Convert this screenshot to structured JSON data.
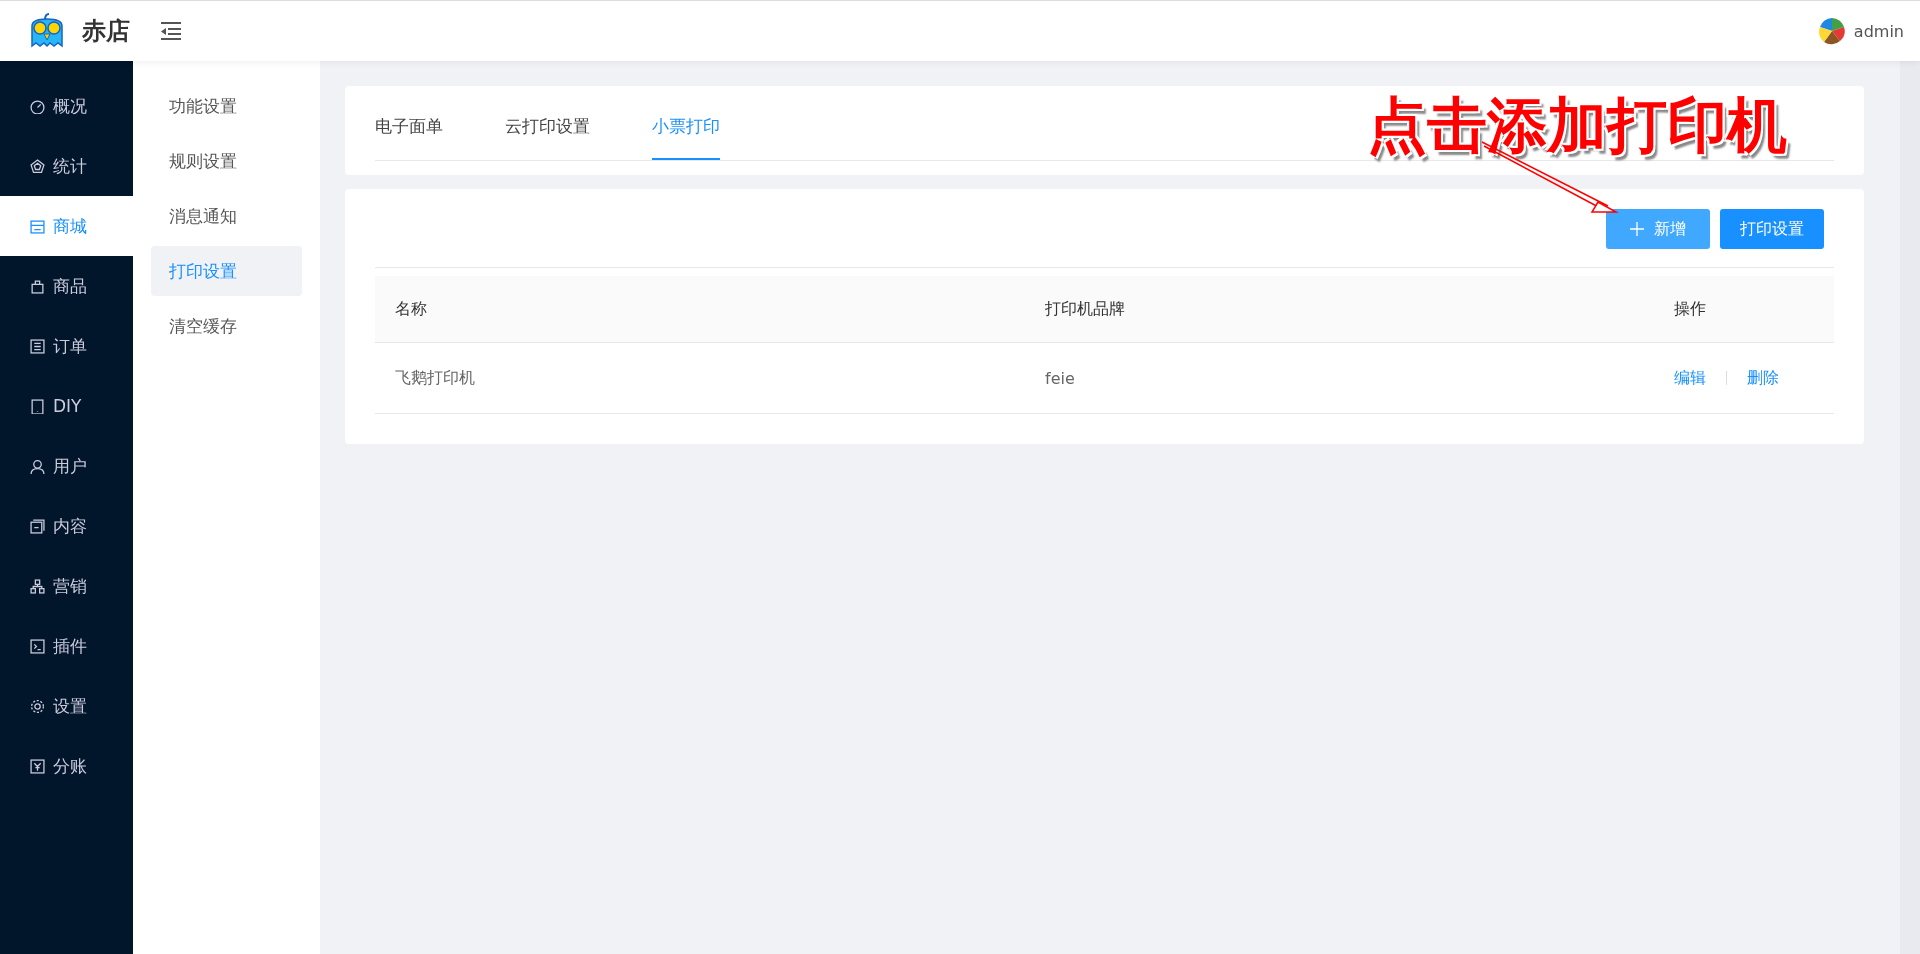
{
  "header": {
    "logo_text": "赤店",
    "user": "admin"
  },
  "main_menu": [
    {
      "label": "概况",
      "selected": false
    },
    {
      "label": "统计",
      "selected": false
    },
    {
      "label": "商城",
      "selected": true
    },
    {
      "label": "商品",
      "selected": false
    },
    {
      "label": "订单",
      "selected": false
    },
    {
      "label": "DIY",
      "selected": false
    },
    {
      "label": "用户",
      "selected": false
    },
    {
      "label": "内容",
      "selected": false
    },
    {
      "label": "营销",
      "selected": false
    },
    {
      "label": "插件",
      "selected": false
    },
    {
      "label": "设置",
      "selected": false
    },
    {
      "label": "分账",
      "selected": false
    }
  ],
  "sub_menu": [
    {
      "label": "功能设置",
      "selected": false
    },
    {
      "label": "规则设置",
      "selected": false
    },
    {
      "label": "消息通知",
      "selected": false
    },
    {
      "label": "打印设置",
      "selected": true
    },
    {
      "label": "清空缓存",
      "selected": false
    }
  ],
  "tabs": [
    {
      "label": "电子面单",
      "selected": false
    },
    {
      "label": "云打印设置",
      "selected": false
    },
    {
      "label": "小票打印",
      "selected": true
    }
  ],
  "buttons": [
    {
      "label": "新增",
      "kind": "add"
    },
    {
      "label": "打印设置",
      "kind": "primary"
    }
  ],
  "table": {
    "columns": [
      "名称",
      "打印机品牌",
      "操作"
    ],
    "rows": [
      {
        "name": "飞鹅打印机",
        "brand": "feie",
        "actions": [
          "编辑",
          "删除"
        ]
      }
    ]
  },
  "annotation": {
    "text": "点击添加打印机"
  }
}
